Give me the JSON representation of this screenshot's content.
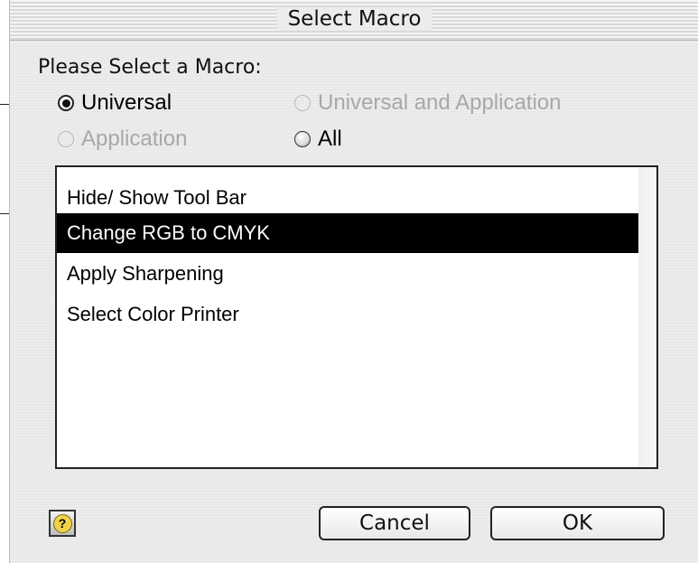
{
  "window": {
    "title": "Select Macro"
  },
  "prompt": "Please Select a Macro:",
  "radios": {
    "universal": {
      "label": "Universal",
      "state": "checked"
    },
    "universal_and_application": {
      "label": "Universal and Application",
      "state": "disabled"
    },
    "application": {
      "label": "Application",
      "state": "disabled"
    },
    "all": {
      "label": "All",
      "state": "unchecked"
    }
  },
  "macro_list": {
    "items": [
      {
        "label": "Hide/ Show Tool Bar",
        "selected": false
      },
      {
        "label": "Change RGB to CMYK",
        "selected": true
      },
      {
        "label": "Apply Sharpening",
        "selected": false
      },
      {
        "label": "Select Color Printer",
        "selected": false
      }
    ]
  },
  "buttons": {
    "help_icon": "help-icon",
    "cancel": "Cancel",
    "ok": "OK"
  }
}
